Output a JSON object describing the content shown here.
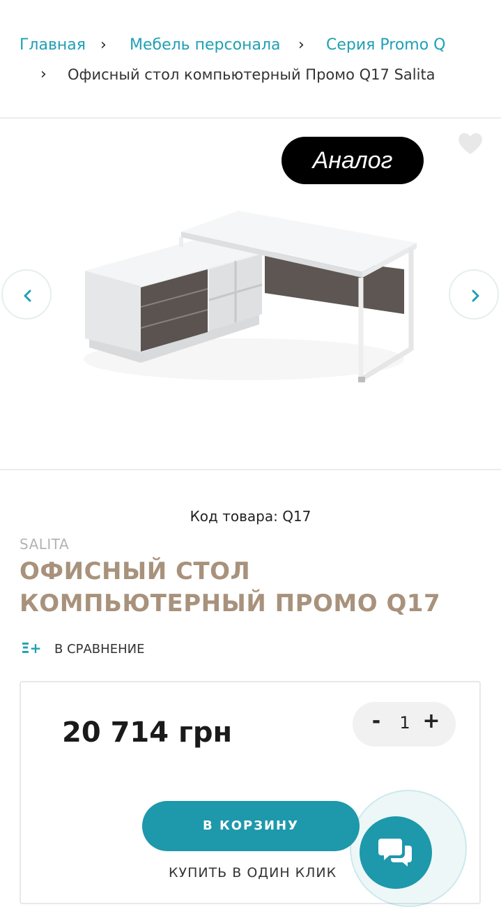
{
  "breadcrumb": {
    "items": [
      "Главная",
      "Мебель персонала",
      "Серия Promo Q"
    ],
    "separator": "›",
    "current": "Офисный стол компьютерный Промо Q17 Salita"
  },
  "gallery": {
    "badge": "Аналог",
    "prev_icon": "chevron-left-icon",
    "next_icon": "chevron-right-icon",
    "favorite_icon": "heart-icon"
  },
  "product": {
    "sku": "Код товара: Q17",
    "brand": "SALITA",
    "title": "ОФИСНЫЙ СТОЛ КОМПЬЮТЕРНЫЙ ПРОМО Q17",
    "compare_label": "В СРАВНЕНИЕ",
    "compare_icon": "Ξ+"
  },
  "purchase": {
    "price": "20 714 грн",
    "qty_minus": "-",
    "qty_value": "1",
    "qty_plus": "+",
    "cart_label": "В КОРЗИНУ",
    "one_click_label": "КУПИТЬ В ОДИН КЛИК"
  },
  "colors": {
    "accent": "#1e98ab",
    "link": "#1fa0b4",
    "title": "#a8927c"
  }
}
